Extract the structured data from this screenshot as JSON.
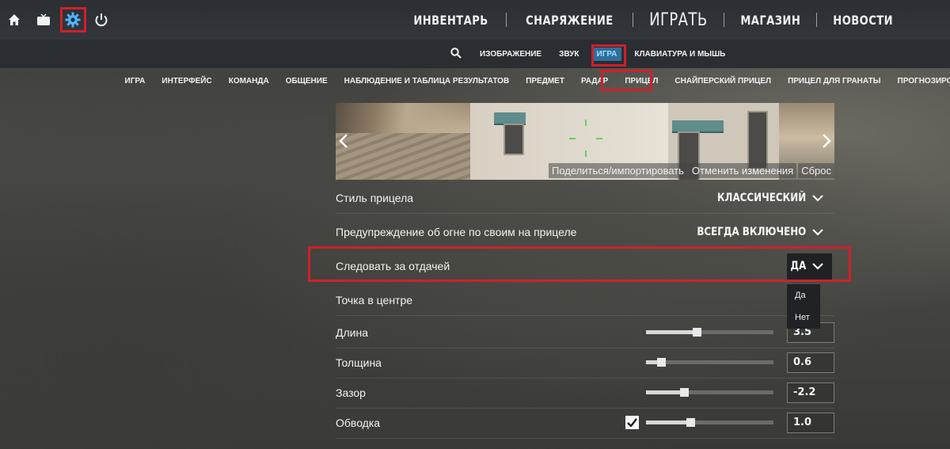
{
  "top_icons": [
    "home-icon",
    "tv-icon",
    "gear-icon",
    "power-icon"
  ],
  "main_nav": {
    "inventory": "ИНВЕНТАРЬ",
    "loadout": "СНАРЯЖЕНИЕ",
    "play": "ИГРАТЬ",
    "shop": "МАГАЗИН",
    "news": "НОВОСТИ"
  },
  "settings_tabs": {
    "video": "ИЗОБРАЖЕНИЕ",
    "audio": "ЗВУК",
    "game": "ИГРА",
    "keyboard_mouse": "КЛАВИАТУРА И МЫШЬ"
  },
  "categories": [
    "ИГРА",
    "ИНТЕРФЕЙС",
    "КОМАНДА",
    "ОБЩЕНИЕ",
    "НАБЛЮДЕНИЕ И ТАБЛИЦА РЕЗУЛЬТАТОВ",
    "ПРЕДМЕТ",
    "РАДАР",
    "ПРИЦЕЛ",
    "СНАЙПЕРСКИЙ ПРИЦЕЛ",
    "ПРИЦЕЛ ДЛЯ ГРАНАТЫ",
    "ПРОГНОЗИРОВАНИЕ"
  ],
  "preview": {
    "share": "Поделиться/импортировать",
    "revert": "Отменить изменения",
    "reset": "Сброс"
  },
  "settings": {
    "style": {
      "label": "Стиль прицела",
      "value": "КЛАССИЧЕСКИЙ"
    },
    "friendly_fire": {
      "label": "Предупреждение об огне по своим на прицеле",
      "value": "ВСЕГДА ВКЛЮЧЕНО"
    },
    "follow_recoil": {
      "label": "Следовать за отдачей",
      "value": "ДА",
      "options": [
        "Да",
        "Нет"
      ]
    },
    "center_dot": {
      "label": "Точка в центре"
    },
    "length": {
      "label": "Длина",
      "value": "3.5",
      "level": 0.4
    },
    "thickness": {
      "label": "Толщина",
      "value": "0.6",
      "level": 0.12
    },
    "gap": {
      "label": "Зазор",
      "value": "-2.2",
      "level": 0.3
    },
    "outline": {
      "label": "Обводка",
      "value": "1.0",
      "level": 0.35,
      "checked": true
    }
  },
  "colors": {
    "accent_active": "#2e6f9c",
    "highlight": "#d0202a"
  }
}
